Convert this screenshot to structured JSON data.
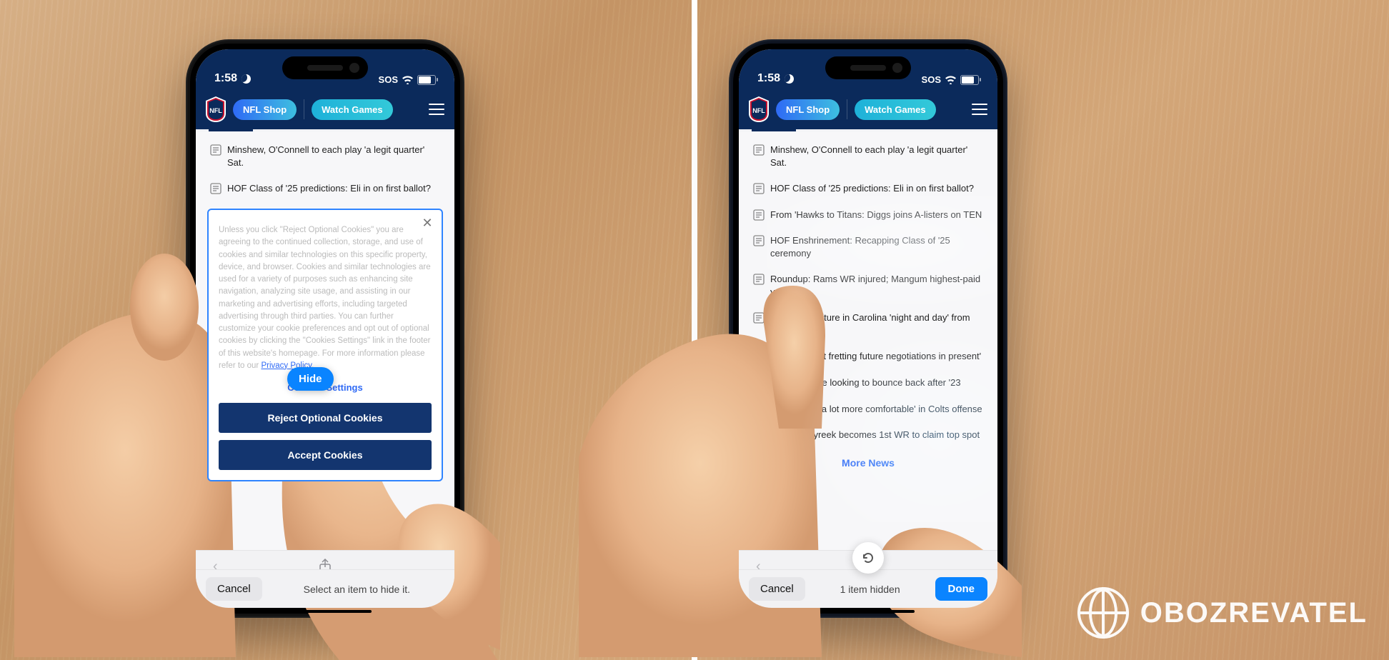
{
  "status": {
    "time": "1:58",
    "sos": "SOS"
  },
  "header": {
    "shop_label": "NFL Shop",
    "watch_label": "Watch Games"
  },
  "left": {
    "news": [
      "Minshew, O'Connell to each play 'a legit quarter' Sat.",
      "HOF Class of '25 predictions: Eli in on first ballot?"
    ],
    "modal": {
      "body": "Unless you click \"Reject Optional Cookies\" you are agreeing to the continued collection, storage, and use of cookies and similar technologies on this specific property, device, and browser. Cookies and similar technologies are used for a variety of purposes such as enhancing site navigation, analyzing site usage, and assisting in our marketing and advertising efforts, including targeted advertising through third parties. You can further customize your cookie preferences and opt out of optional cookies by clicking the \"Cookies Settings\" link in the footer of this website's homepage. For more information please refer to our",
      "privacy": "Privacy Policy.",
      "settings_link": "Cookies Settings",
      "reject": "Reject Optional Cookies",
      "accept": "Accept Cookies"
    },
    "hide_label": "Hide",
    "bottom": {
      "cancel": "Cancel",
      "center": "Select an item to hide it."
    }
  },
  "right": {
    "news": [
      "Minshew, O'Connell to each play 'a legit quarter' Sat.",
      "HOF Class of '25 predictions: Eli in on first ballot?",
      "From 'Hawks to Titans: Diggs joins A-listers on TEN",
      "HOF Enshrinement: Recapping Class of '25 ceremony",
      "Roundup: Rams WR injured; Mangum highest-paid year",
      "Sanders: Culture in Carolina 'night and day' from '23",
      "QB Purdy not fretting future negotiations in present'",
      "Chiefs' Moore looking to bounce back after '23",
      "Richardson 'a lot more comfortable' in Colts offense",
      "Top 100: Tyreek becomes 1st WR to claim top spot"
    ],
    "more_news": "More News",
    "bottom": {
      "cancel": "Cancel",
      "center": "1 item hidden",
      "done": "Done"
    }
  },
  "watermark": "OBOZREVATEL"
}
